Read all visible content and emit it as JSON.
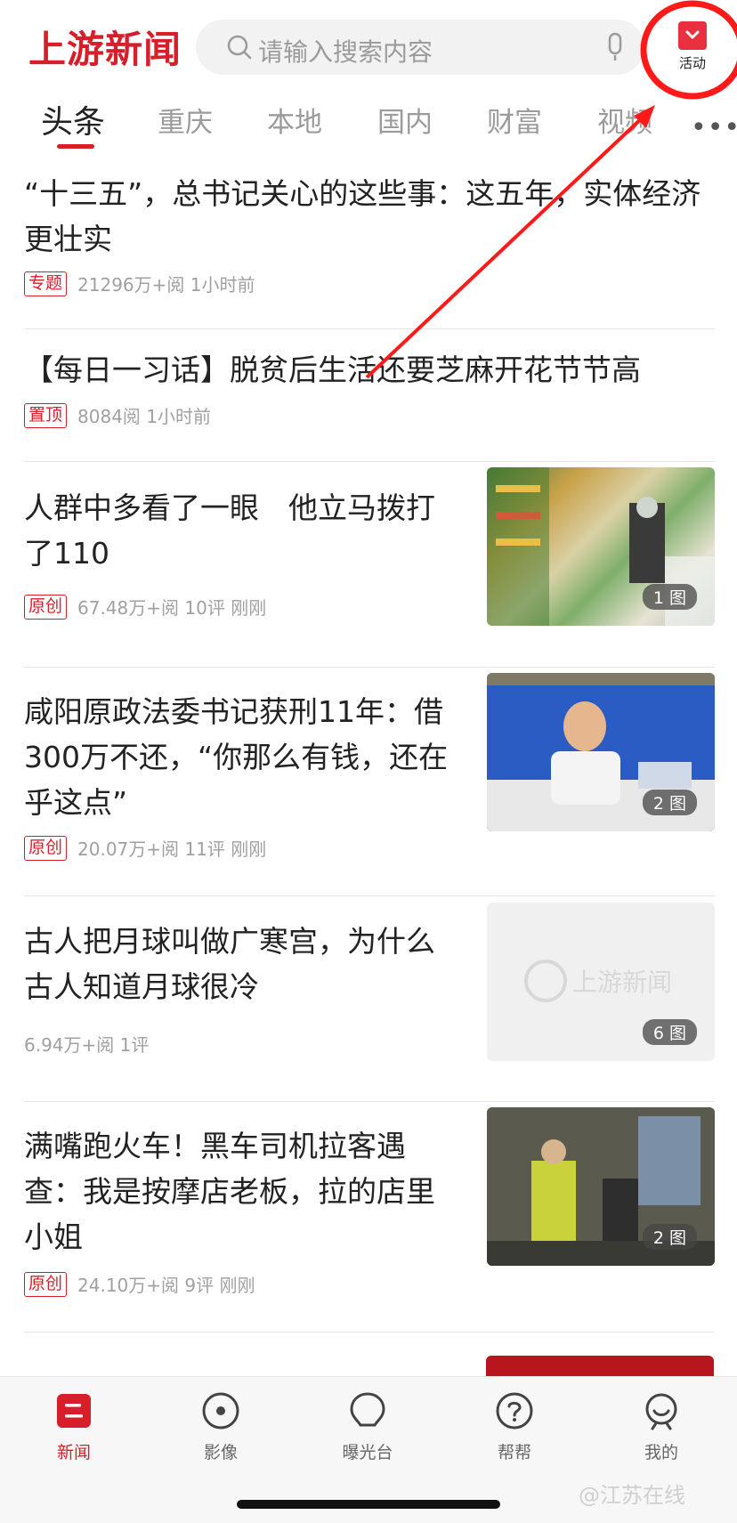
{
  "header": {
    "logo": "上游新闻",
    "search_placeholder": "请输入搜索内容",
    "activity_label": "活动"
  },
  "tabs": [
    "头条",
    "重庆",
    "本地",
    "国内",
    "财富",
    "视频"
  ],
  "feed": [
    {
      "title": "“十三五”，总书记关心的这些事：这五年，实体经济更壮实",
      "tag": "专题",
      "meta": "21296万+阅 1小时前"
    },
    {
      "title": "【每日一习话】脱贫后生活还要芝麻开花节节高",
      "tag": "置顶",
      "meta": "8084阅 1小时前"
    },
    {
      "title": "人群中多看了一眼　他立马拨打了110",
      "tag": "原创",
      "meta": "67.48万+阅 10评 刚刚",
      "image_count": "1 图"
    },
    {
      "title": "咸阳原政法委书记获刑11年：借300万不还，“你那么有钱，还在乎这点”",
      "tag": "原创",
      "meta": "20.07万+阅 11评 刚刚",
      "image_count": "2 图"
    },
    {
      "title": "古人把月球叫做广寒宫，为什么古人知道月球很冷",
      "tag": "",
      "meta": "6.94万+阅 1评",
      "image_count": "6 图",
      "placeholder_logo": "上游新闻"
    },
    {
      "title": "满嘴跑火车！黑车司机拉客遇查：我是按摩店老板，拉的店里小姐",
      "tag": "原创",
      "meta": "24.10万+阅 9评 刚刚",
      "image_count": "2 图"
    }
  ],
  "tabbar": [
    {
      "label": "新闻",
      "icon": "news-icon"
    },
    {
      "label": "影像",
      "icon": "video-icon"
    },
    {
      "label": "曝光台",
      "icon": "exposure-icon"
    },
    {
      "label": "帮帮",
      "icon": "help-icon"
    },
    {
      "label": "我的",
      "icon": "profile-icon"
    }
  ],
  "watermark": "@江苏在线",
  "colors": {
    "brand": "#d71e2b",
    "annotation": "#ff1a1a"
  }
}
